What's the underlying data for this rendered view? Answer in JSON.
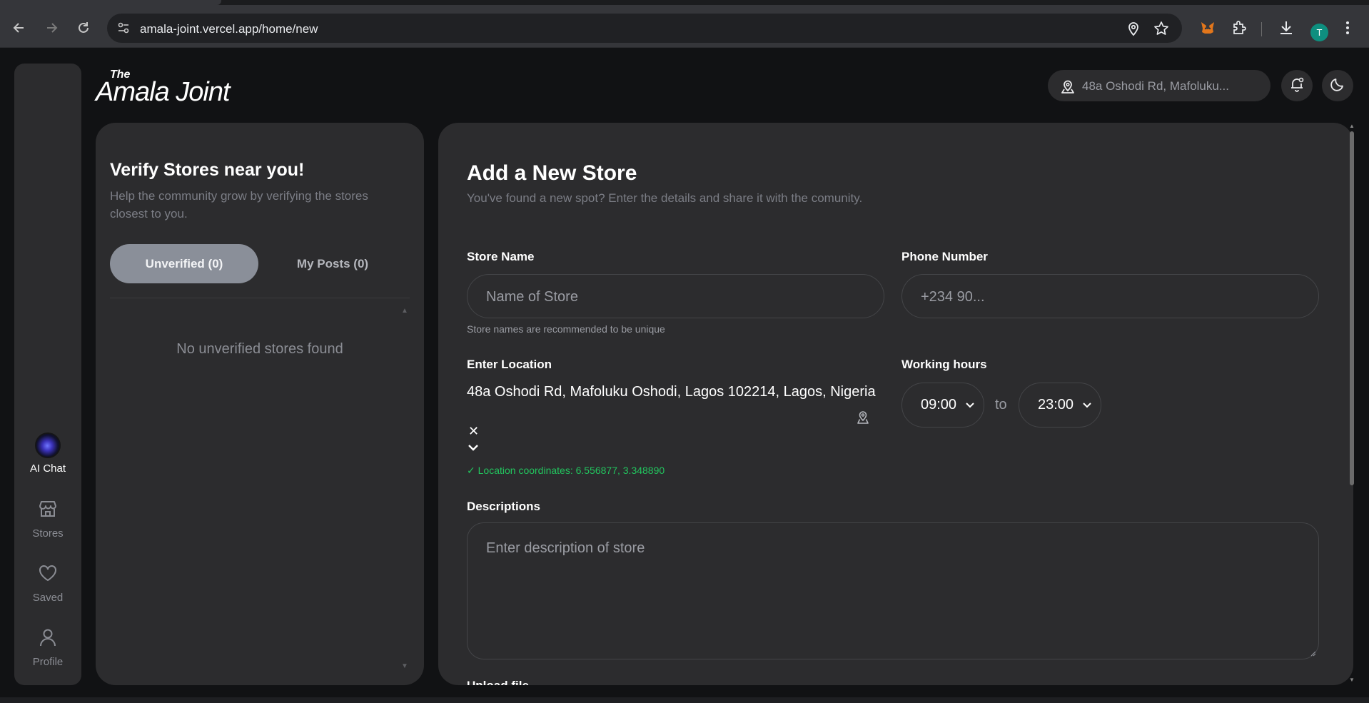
{
  "browser": {
    "url": "amala-joint.vercel.app/home/new",
    "avatar_letter": "T"
  },
  "sidebar": {
    "items": [
      {
        "label": "AI Chat",
        "icon": "ai-orb-icon"
      },
      {
        "label": "Stores",
        "icon": "store-icon"
      },
      {
        "label": "Saved",
        "icon": "heart-icon"
      },
      {
        "label": "Profile",
        "icon": "user-icon"
      }
    ]
  },
  "header": {
    "logo_small": "The",
    "logo_main": "Amala Joint",
    "location_pill": "48a Oshodi Rd, Mafoluku..."
  },
  "verify_panel": {
    "title": "Verify Stores near you!",
    "subtitle": "Help the community grow by verifying the stores closest to you.",
    "tabs": [
      {
        "label": "Unverified (0)",
        "active": true
      },
      {
        "label": "My Posts (0)",
        "active": false
      }
    ],
    "empty_message": "No unverified stores found"
  },
  "add_store": {
    "title": "Add a New Store",
    "subtitle": "You've found a new spot? Enter the details and share it with the comunity.",
    "store_name": {
      "label": "Store Name",
      "placeholder": "Name of Store",
      "hint": "Store names are recommended to be unique"
    },
    "phone": {
      "label": "Phone Number",
      "placeholder": "+234 90..."
    },
    "location": {
      "label": "Enter Location",
      "value": "48a Oshodi Rd, Mafoluku Oshodi, Lagos 102214, Lagos, Nigeria",
      "clear": "✕",
      "coords": "✓ Location coordinates: 6.556877, 3.348890"
    },
    "working_hours": {
      "label": "Working hours",
      "open": "09:00",
      "separator": "to",
      "close": "23:00"
    },
    "descriptions": {
      "label": "Descriptions",
      "placeholder": "Enter description of store"
    },
    "upload_label": "Upload file"
  },
  "colors": {
    "background": "#111214",
    "panel": "#2c2c2e",
    "active_tab": "#8a8f99",
    "success": "#22c55e"
  }
}
